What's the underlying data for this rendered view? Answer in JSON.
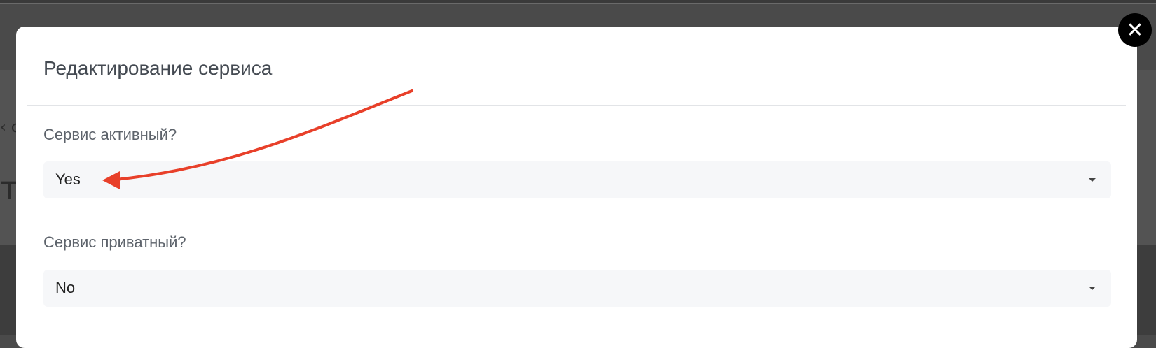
{
  "modal": {
    "title": "Редактирование сервиса",
    "close_icon": "close-icon"
  },
  "fields": [
    {
      "label": "Сервис активный?",
      "value": "Yes"
    },
    {
      "label": "Сервис приватный?",
      "value": "No"
    }
  ],
  "annotation": {
    "arrow_color": "#e8402a"
  },
  "background": {
    "fragment_1": "‹ с",
    "fragment_2": "ти"
  }
}
